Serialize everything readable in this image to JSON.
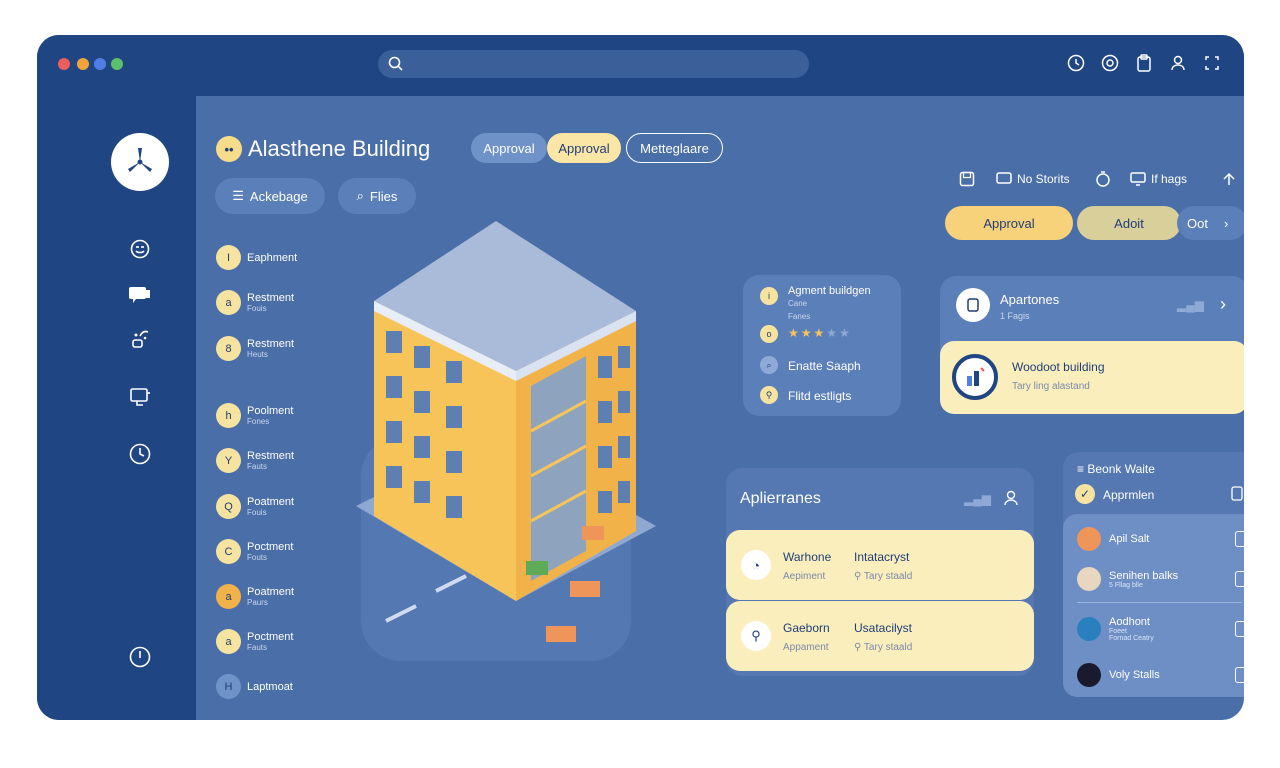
{
  "window": {
    "dots": [
      "#ef5c5c",
      "#f2c94c",
      "#4f7fe6",
      "#5cc16c"
    ]
  },
  "toolbar": {
    "icons": [
      "clock-icon",
      "refresh-icon",
      "clipboard-icon",
      "user-icon",
      "expand-icon"
    ]
  },
  "sidebar": {
    "logo_icon": "wind-turbine-icon",
    "icons": [
      "emoji-icon",
      "chat-icon",
      "share-icon",
      "monitor-icon",
      "clock-icon",
      "power-icon"
    ]
  },
  "header": {
    "badge": "••",
    "title": "Alasthene Building",
    "tabs": [
      "Approval",
      "Approval",
      "Metteglaare"
    ],
    "actions": [
      "Ackebage",
      "Flies"
    ]
  },
  "toolbar_right": {
    "items": [
      "No Storits",
      "If hags"
    ],
    "buttons": [
      "Approval",
      "Adoit",
      "Oot"
    ]
  },
  "list": [
    {
      "badge": "I",
      "title": "Eaphment",
      "sub": ""
    },
    {
      "badge": "a",
      "title": "Restment",
      "sub": "Fouis"
    },
    {
      "badge": "8",
      "title": "Restment",
      "sub": "Heuts"
    },
    {
      "badge": "h",
      "title": "Poolment",
      "sub": "Fones"
    },
    {
      "badge": "Y",
      "title": "Restment",
      "sub": "Fauts"
    },
    {
      "badge": "Q",
      "title": "Poatment",
      "sub": "Fouis"
    },
    {
      "badge": "C",
      "title": "Poctment",
      "sub": "Fouts"
    },
    {
      "badge": "a",
      "title": "Poatment",
      "sub": "Paurs"
    },
    {
      "badge": "a",
      "title": "Poctment",
      "sub": "Fauts"
    },
    {
      "badge": "H",
      "title": "Laptmoat",
      "sub": ""
    }
  ],
  "info_card": {
    "title": "Agment buildgen",
    "sub1": "Cane",
    "sub2": "Fanes",
    "rating": 3,
    "rating_max": 5,
    "line1": "Enatte Saaph",
    "line2": "Flitd estligts"
  },
  "apartments_card": {
    "title": "Apartones",
    "sub": "1 Fagis",
    "featured_title": "Woodoot building",
    "featured_sub": "Tary ling alastand"
  },
  "appliances": {
    "title": "Aplierranes",
    "items": [
      {
        "name": "Warhone",
        "type": "Aepiment",
        "status": "Intatacryst",
        "detail": "Tary staald"
      },
      {
        "name": "Gaeborn",
        "type": "Appament",
        "status": "Usatacilyst",
        "detail": "Tary staald"
      }
    ]
  },
  "people_panel": {
    "header": "Beonk Waite",
    "selected": "Apprmlen",
    "people": [
      {
        "name": "Apil Salt",
        "sub": ""
      },
      {
        "name": "Senihen balks",
        "sub": "5 Fllag blle"
      },
      {
        "name": "Aodhont",
        "sub1": "Foeet",
        "sub2": "Fornad Ceatry"
      },
      {
        "name": "Voly Stalls",
        "sub": ""
      }
    ]
  },
  "colors": {
    "window_bg": "#4a6ea8",
    "sidebar_bg": "#1f4583",
    "accent_yellow": "#f7d27a",
    "card_yellow": "#fbeebd"
  }
}
